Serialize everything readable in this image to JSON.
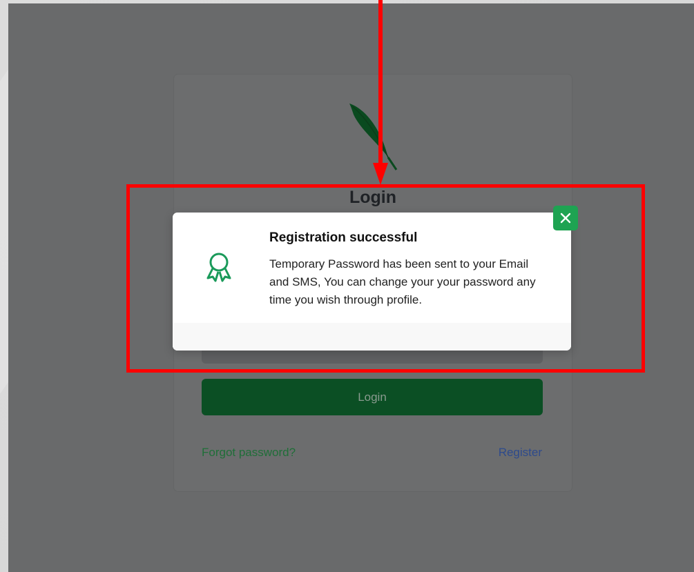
{
  "page": {
    "login_title": "Login",
    "login_button": "Login",
    "forgot_link": "Forgot password?",
    "register_link": "Register"
  },
  "modal": {
    "title": "Registration successful",
    "message": "Temporary Password has been sent to your Email and SMS, You can change your your password any time you wish through profile.",
    "icon": "award-icon",
    "close_icon": "close-icon"
  },
  "colors": {
    "brand_green": "#0b4f24",
    "close_green": "#1ea352",
    "icon_green": "#1a9a5a",
    "annotation_red": "#ff0000"
  }
}
